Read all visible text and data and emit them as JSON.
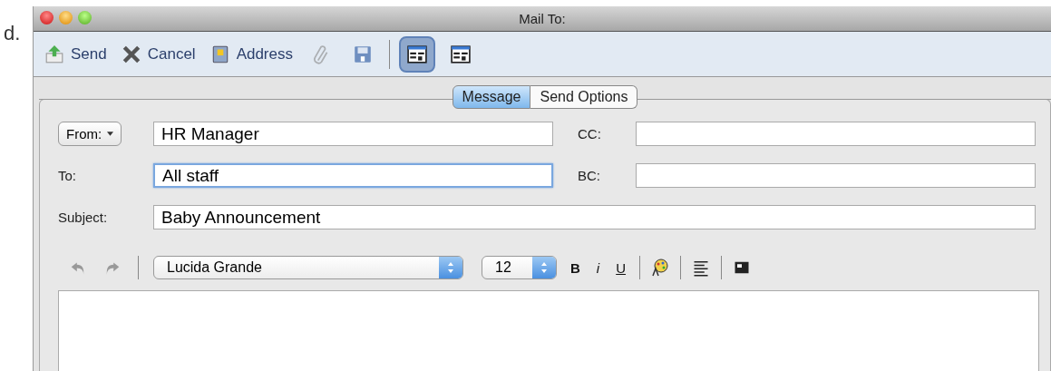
{
  "figure_label": "d.",
  "window": {
    "title": "Mail To:"
  },
  "toolbar": {
    "buttons": [
      {
        "label": "Send"
      },
      {
        "label": "Cancel"
      },
      {
        "label": "Address"
      }
    ],
    "attach_disabled": true,
    "views": [
      {
        "selected": true
      },
      {
        "selected": false
      }
    ]
  },
  "tabs": [
    {
      "label": "Message",
      "selected": true
    },
    {
      "label": "Send Options",
      "selected": false
    }
  ],
  "from": {
    "button": "From:",
    "value": "HR Manager",
    "focused": false
  },
  "cc": {
    "label": "CC:",
    "focused": false
  },
  "to": {
    "label": "To:",
    "value": "All staff",
    "focused": true
  },
  "bc": {
    "label": "BC:",
    "focused": false
  },
  "subject": {
    "label": "Subject:",
    "value": "Baby Announcement",
    "focused": false
  },
  "editor_toolbar": {
    "font": "Lucida Grande",
    "size": "12",
    "format_buttons": [
      "B",
      "i",
      "U"
    ]
  }
}
